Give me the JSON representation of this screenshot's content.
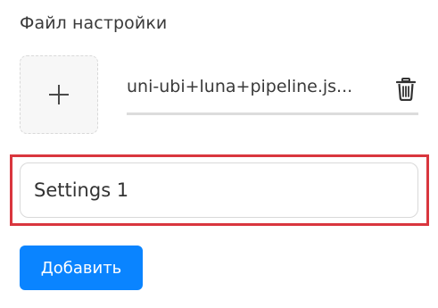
{
  "settings_file": {
    "label": "Файл настройки",
    "file_name": "uni-ubi+luna+pipeline.js...",
    "upload_icon": "plus-icon",
    "delete_icon": "trash-icon"
  },
  "settings_name": {
    "value": "Settings 1"
  },
  "actions": {
    "add_label": "Добавить"
  },
  "colors": {
    "highlight": "#d9363e",
    "primary": "#0a84ff"
  }
}
